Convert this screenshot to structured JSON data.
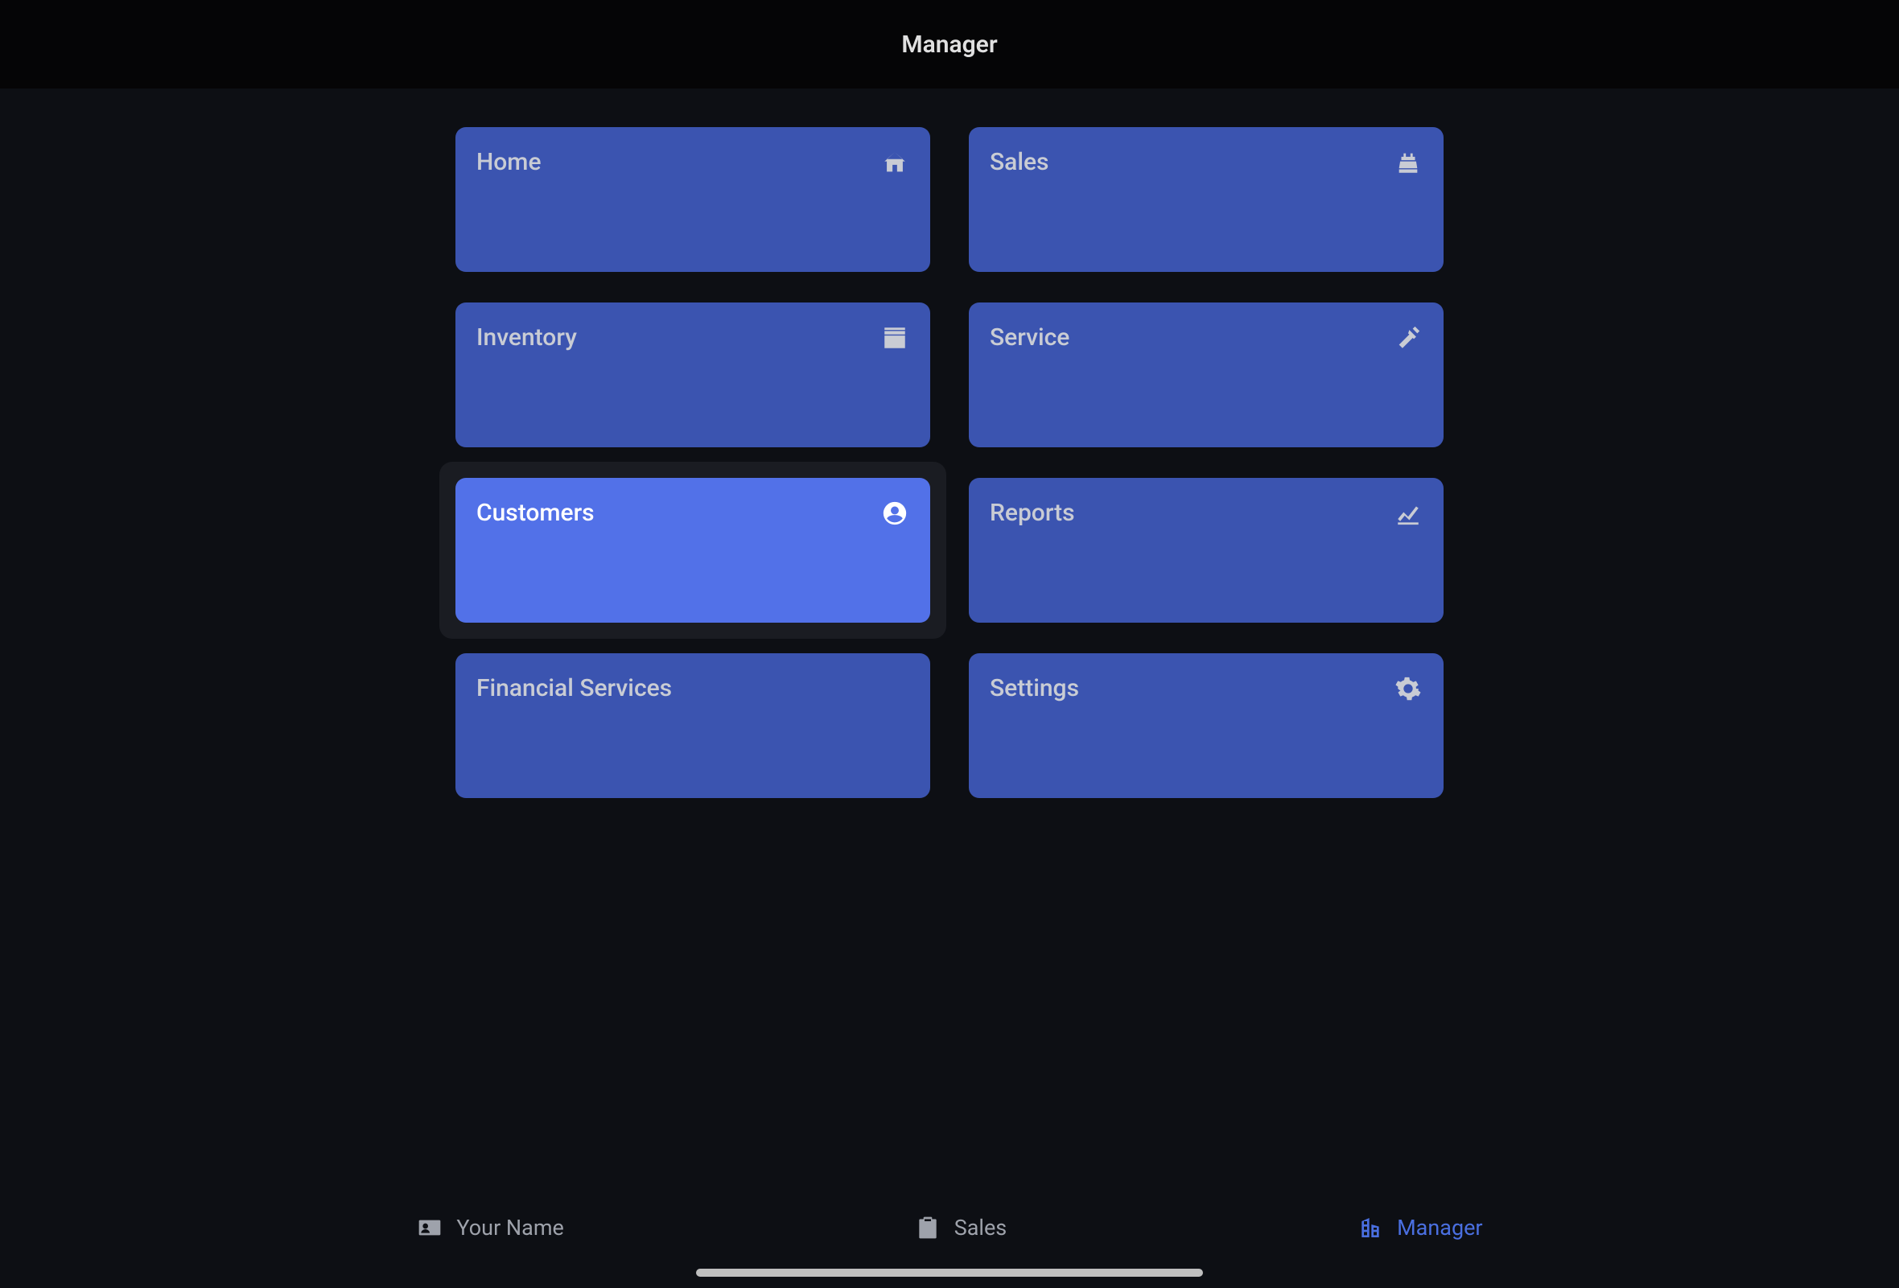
{
  "header": {
    "title": "Manager"
  },
  "tiles": [
    {
      "label": "Home",
      "icon": "home-icon",
      "active": false
    },
    {
      "label": "Sales",
      "icon": "cash-register-icon",
      "active": false
    },
    {
      "label": "Inventory",
      "icon": "box-icon",
      "active": false
    },
    {
      "label": "Service",
      "icon": "hammer-icon",
      "active": false
    },
    {
      "label": "Customers",
      "icon": "user-circle-icon",
      "active": true
    },
    {
      "label": "Reports",
      "icon": "chart-line-icon",
      "active": false
    },
    {
      "label": "Financial Services",
      "icon": "none",
      "active": false
    },
    {
      "label": "Settings",
      "icon": "gear-icon",
      "active": false
    }
  ],
  "bottom_tabs": [
    {
      "label": "Your Name",
      "icon": "id-card-icon",
      "active": false
    },
    {
      "label": "Sales",
      "icon": "clipboard-icon",
      "active": false
    },
    {
      "label": "Manager",
      "icon": "building-icon",
      "active": true
    }
  ],
  "colors": {
    "tile_bg": "#3b54b0",
    "tile_active_bg": "#5271e8",
    "page_bg": "#0d0f14",
    "header_bg": "#050506",
    "accent": "#4a6fe0",
    "muted_text": "#9ea2ab"
  }
}
